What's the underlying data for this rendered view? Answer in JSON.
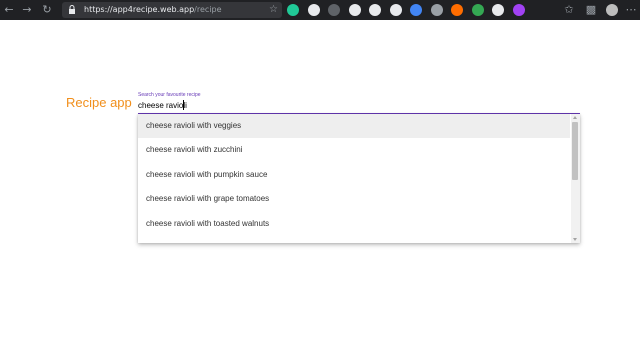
{
  "browser": {
    "url_host": "https://app4recipe.web.app",
    "url_path": "/recipe",
    "extension_colors": [
      "#20c997",
      "#e8eaed",
      "#5f6368",
      "#e8eaed",
      "#e8eaed",
      "#e8eaed",
      "#4285f4",
      "#9aa0a6",
      "#ff6d00",
      "#34a853",
      "#e8eaed",
      "#a142f4"
    ]
  },
  "page": {
    "app_title": "Recipe app",
    "search": {
      "label": "Search your favourite recipe",
      "value": "cheese ravioli"
    },
    "suggestions": [
      "cheese ravioli with veggies",
      "cheese ravioli with zucchini",
      "cheese ravioli with pumpkin sauce",
      "cheese ravioli with grape tomatoes",
      "cheese ravioli with toasted walnuts"
    ],
    "accent_color": "#673ab7",
    "title_color": "#f18f1c"
  }
}
